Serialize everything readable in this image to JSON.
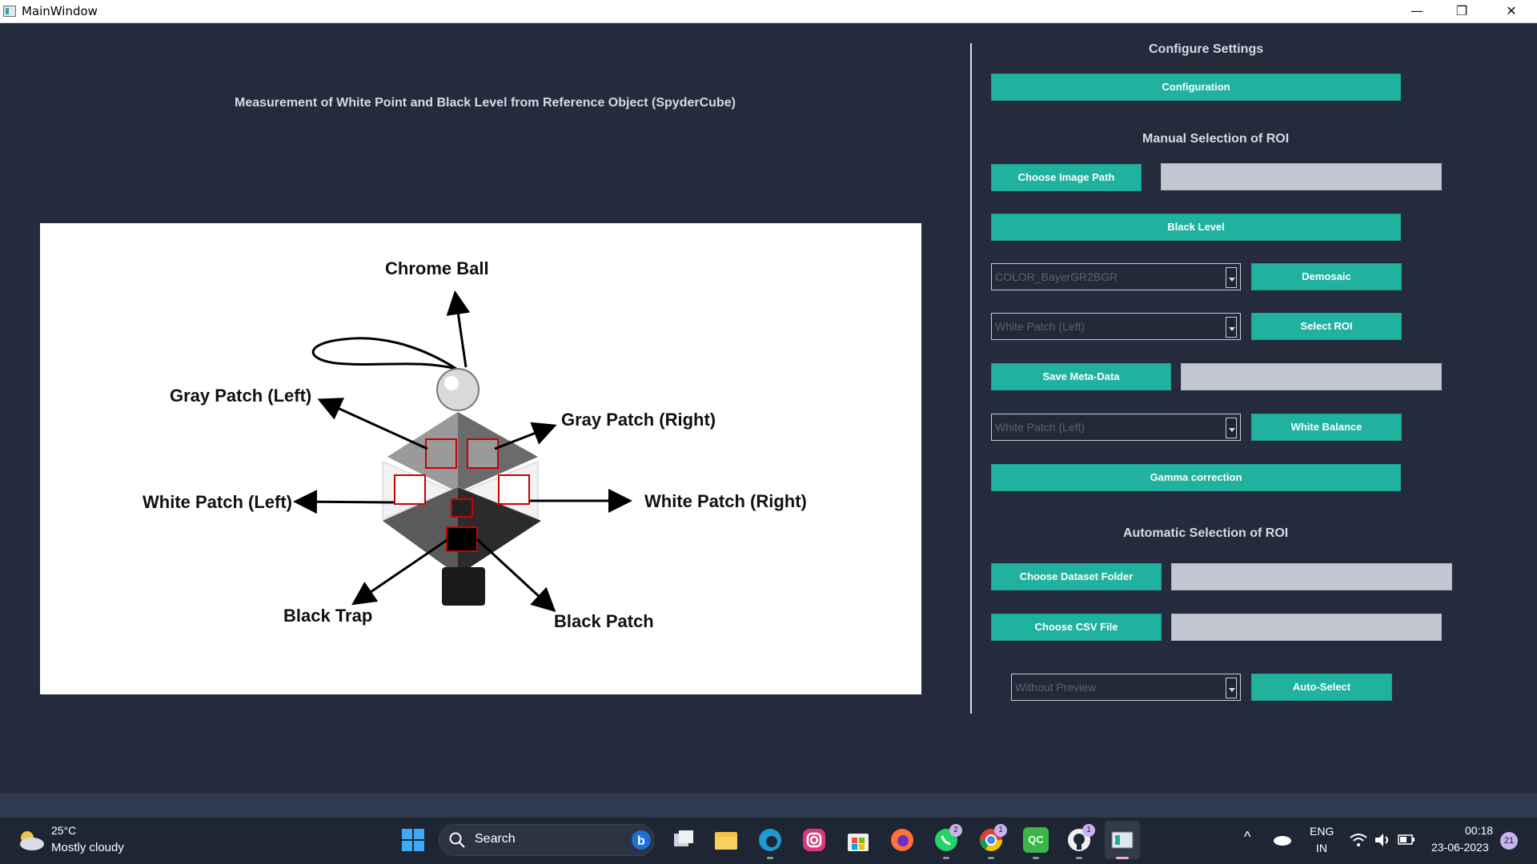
{
  "window": {
    "title": "MainWindow",
    "minimize_glyph": "—",
    "maximize_glyph": "❐",
    "close_glyph": "✕"
  },
  "left_panel": {
    "heading": "Measurement of White Point and Black Level from Reference Object (SpyderCube)",
    "diagram_labels": {
      "chrome_ball": "Chrome Ball",
      "gray_left": "Gray Patch (Left)",
      "gray_right": "Gray Patch (Right)",
      "white_left": "White Patch (Left)",
      "white_right": "White Patch (Right)",
      "black_trap": "Black Trap",
      "black_patch": "Black Patch"
    }
  },
  "right_panel": {
    "configure_heading": "Configure Settings",
    "configuration_button": "Configuration",
    "manual_heading": "Manual Selection of ROI",
    "choose_image_path_button": "Choose Image Path",
    "image_path_value": "",
    "black_level_button": "Black Level",
    "demosaic_combo_value": "COLOR_BayerGR2BGR",
    "demosaic_button": "Demosaic",
    "roi_combo_value": "White Patch (Left)",
    "select_roi_button": "Select ROI",
    "save_metadata_button": "Save Meta-Data",
    "metadata_value": "",
    "wb_combo_value": "White Patch (Left)",
    "white_balance_button": "White Balance",
    "gamma_button": "Gamma correction",
    "auto_heading": "Automatic Selection of ROI",
    "choose_dataset_button": "Choose Dataset Folder",
    "dataset_value": "",
    "choose_csv_button": "Choose CSV File",
    "csv_value": "",
    "preview_combo_value": "Without Preview",
    "auto_select_button": "Auto-Select"
  },
  "taskbar": {
    "weather_temp": "25°C",
    "weather_desc": "Mostly cloudy",
    "search_label": "Search",
    "lang_line1": "ENG",
    "lang_line2": "IN",
    "time": "00:18",
    "date": "23-06-2023",
    "notification_count": "21",
    "whatsapp_badge": "2",
    "chrome_badge": "1",
    "github_badge": "1",
    "qc_label": "QC",
    "chevron_glyph": "^"
  },
  "colors": {
    "accent": "#20b29f",
    "background": "#232b3c",
    "field": "#c3c7d1"
  }
}
